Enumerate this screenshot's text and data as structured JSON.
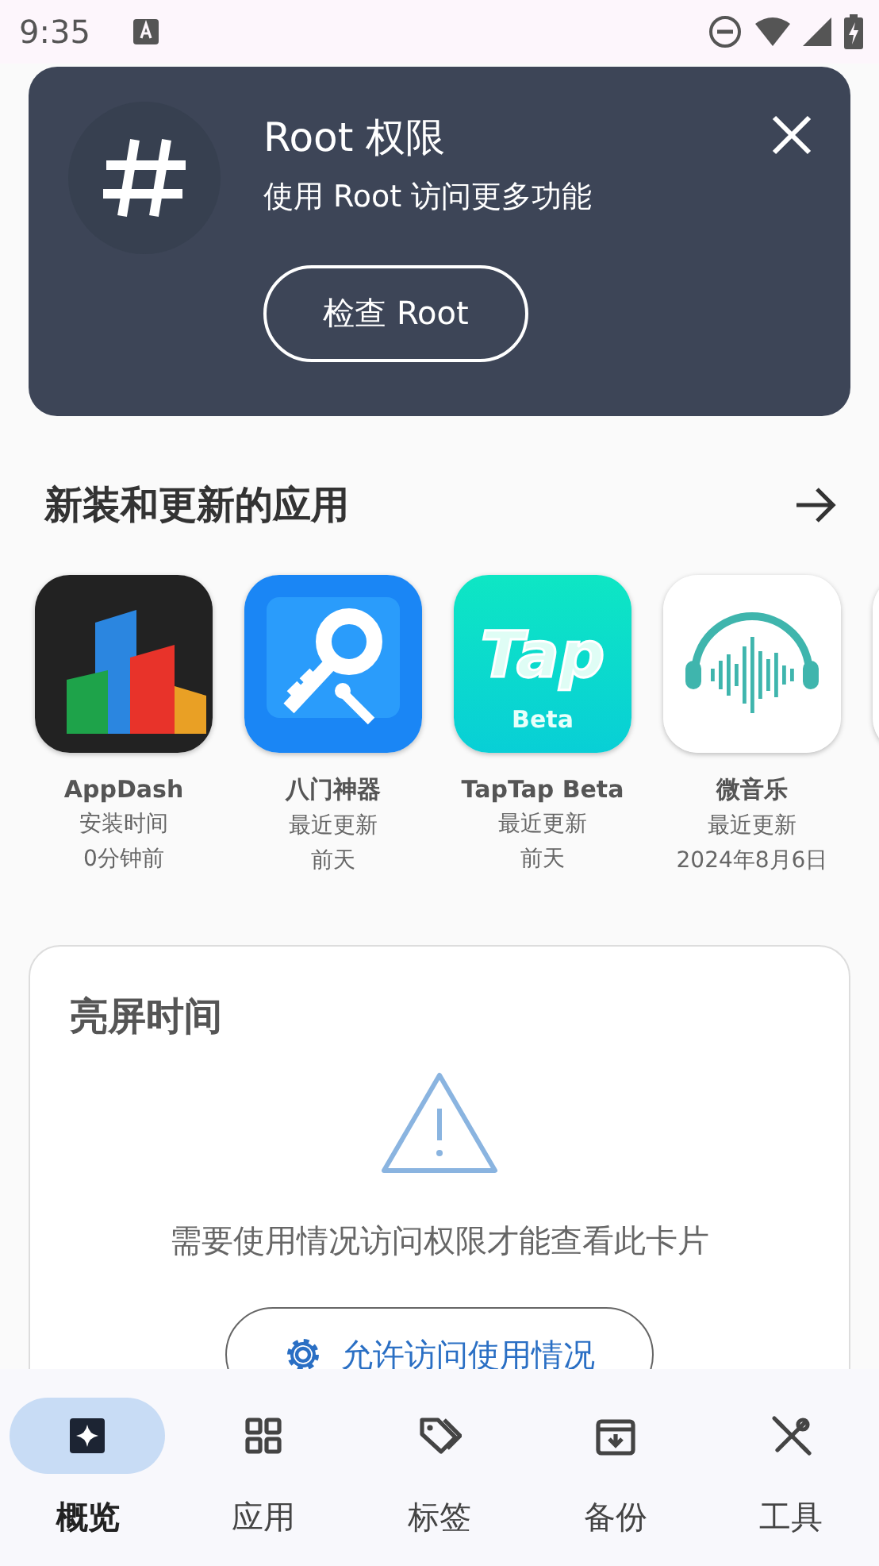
{
  "status_bar": {
    "time": "9:35"
  },
  "root_card": {
    "title": "Root 权限",
    "subtitle": "使用 Root 访问更多功能",
    "button": "检查 Root"
  },
  "recent_apps": {
    "title": "新装和更新的应用",
    "apps": [
      {
        "name": "AppDash",
        "status": "安装时间",
        "time": "0分钟前"
      },
      {
        "name": "八门神器",
        "status": "最近更新",
        "time": "前天"
      },
      {
        "name": "TapTap Beta",
        "status": "最近更新",
        "time": "前天",
        "icon_text": "Tap",
        "icon_subtext": "Beta"
      },
      {
        "name": "微音乐",
        "status": "最近更新",
        "time": "2024年8月6日"
      }
    ]
  },
  "screen_time": {
    "title": "亮屏时间",
    "message": "需要使用情况访问权限才能查看此卡片",
    "button": "允许访问使用情况"
  },
  "nav": [
    {
      "label": "概览",
      "selected": true
    },
    {
      "label": "应用",
      "selected": false
    },
    {
      "label": "标签",
      "selected": false
    },
    {
      "label": "备份",
      "selected": false
    },
    {
      "label": "工具",
      "selected": false
    }
  ]
}
